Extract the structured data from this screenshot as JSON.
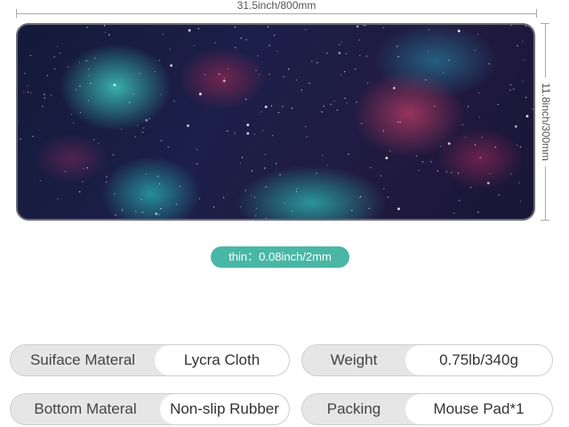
{
  "dimensions": {
    "width_label": "31.5inch/800mm",
    "height_label": "11.8inch/300mm",
    "thickness_label": "thin：0.08inch/2mm"
  },
  "product_image": {
    "subject": "galaxy-nebula-mouse-pad",
    "colors": {
      "teal": "#3cc8be",
      "magenta": "#be3c64",
      "deep_space": "#1c1f4a"
    }
  },
  "specs": [
    {
      "key": "Suiface Materal",
      "value": "Lycra Cloth"
    },
    {
      "key": "Weight",
      "value": "0.75lb/340g"
    },
    {
      "key": "Bottom Materal",
      "value": "Non-slip Rubber"
    },
    {
      "key": "Packing",
      "value": "Mouse Pad*1"
    }
  ],
  "accent_color": "#48b7a5"
}
